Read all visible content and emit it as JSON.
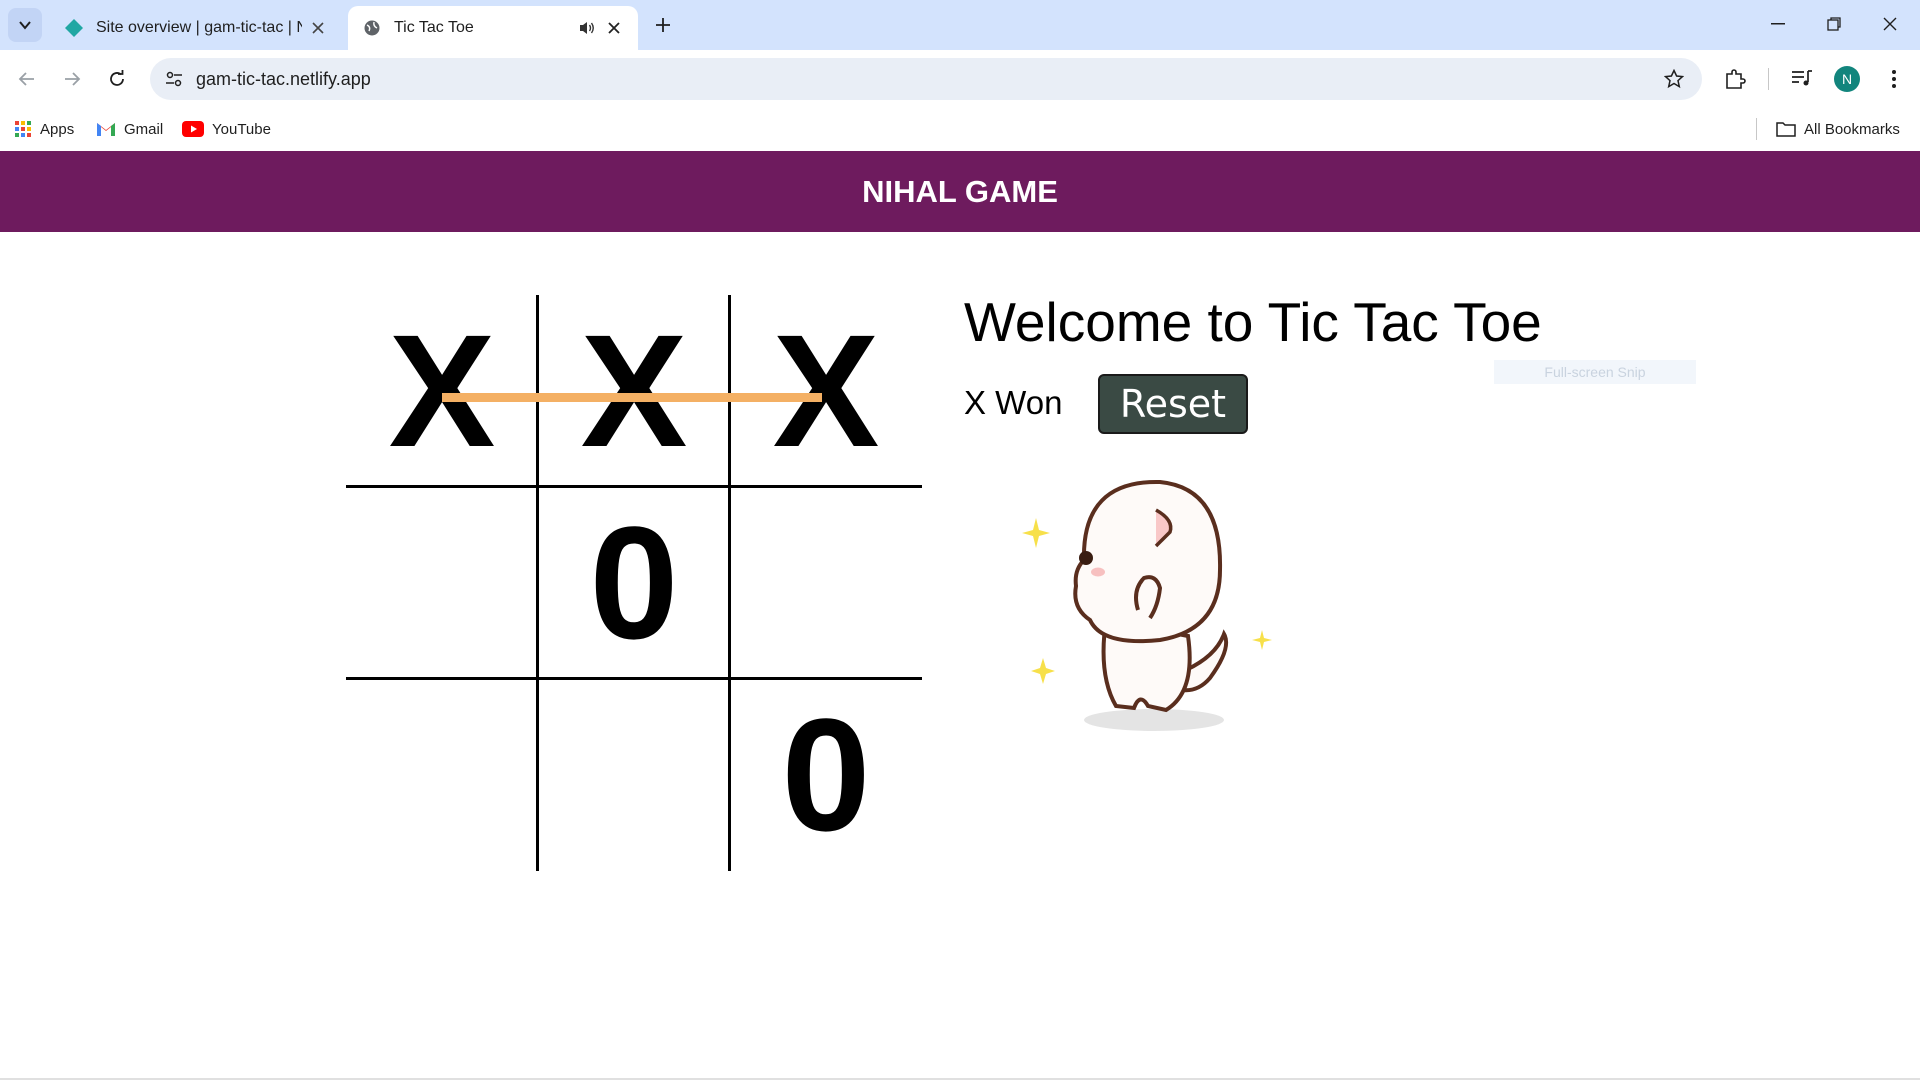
{
  "browser": {
    "tabs": [
      {
        "title": "Site overview | gam-tic-tac | Ne",
        "active": false,
        "favicon": "netlify-diamond-icon"
      },
      {
        "title": "Tic Tac Toe",
        "active": true,
        "favicon": "globe-icon",
        "audio": true
      }
    ],
    "url": "gam-tic-tac.netlify.app",
    "profile_initial": "N",
    "bookmarks": [
      {
        "label": "Apps",
        "icon": "apps-grid-icon"
      },
      {
        "label": "Gmail",
        "icon": "gmail-icon"
      },
      {
        "label": "YouTube",
        "icon": "youtube-icon"
      }
    ],
    "all_bookmarks": "All Bookmarks"
  },
  "page": {
    "header_title": "NIHAL GAME",
    "welcome": "Welcome to Tic Tac Toe",
    "status": "X Won",
    "reset_label": "Reset",
    "snip_overlay": "Full-screen Snip",
    "board": [
      [
        "X",
        "X",
        "X"
      ],
      [
        "",
        "0",
        ""
      ],
      [
        "",
        "",
        "0"
      ]
    ],
    "winning_row": 0,
    "colors": {
      "header_bg": "#6e1b5e",
      "strike": "#f4b064",
      "reset_bg": "#3a4a44"
    }
  }
}
